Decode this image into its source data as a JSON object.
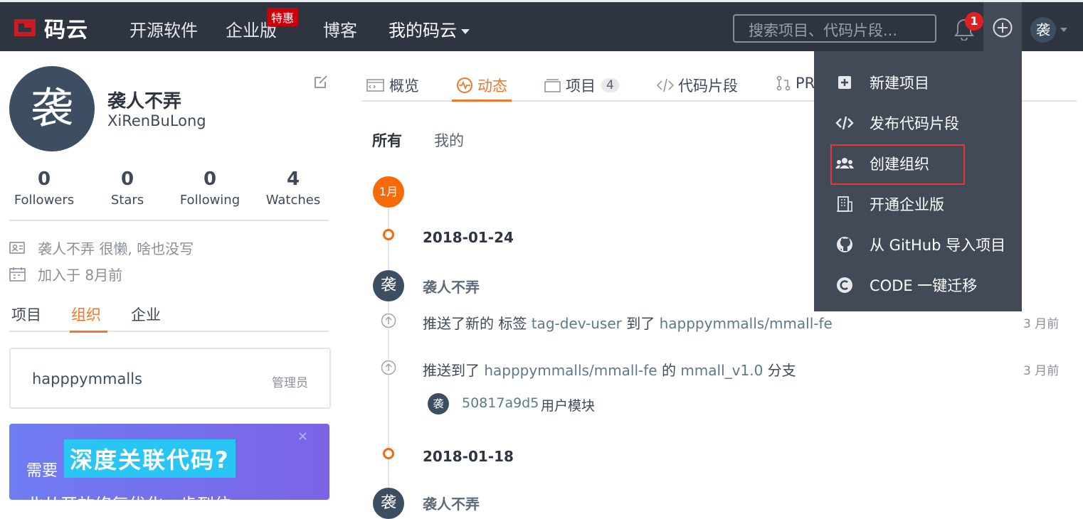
{
  "nav": {
    "logo_text": "码云",
    "items": [
      "开源软件",
      "企业版",
      "博客",
      "我的码云"
    ],
    "hot_badge": "特惠",
    "search_placeholder": "搜索项目、代码片段...",
    "notification_count": "1",
    "user_initial": "袭"
  },
  "profile": {
    "avatar_char": "袭",
    "name": "袭人不弄",
    "username": "XiRenBuLong",
    "stats": [
      {
        "value": "0",
        "label": "Followers"
      },
      {
        "value": "0",
        "label": "Stars"
      },
      {
        "value": "0",
        "label": "Following"
      },
      {
        "value": "4",
        "label": "Watches"
      }
    ],
    "bio": "袭人不弄 很懒, 啥也没写",
    "joined": "加入于 8月前",
    "tabs": [
      "项目",
      "组织",
      "企业"
    ],
    "active_tab": "组织",
    "org": {
      "name": "happpymmalls",
      "role": "管理员"
    },
    "promo": {
      "small": "需要",
      "big": "深度关联代码?",
      "tail": "北从开放修复优化一步到位"
    }
  },
  "main": {
    "tabs": [
      {
        "label": "概览",
        "icon": "overview-icon"
      },
      {
        "label": "动态",
        "icon": "activity-icon"
      },
      {
        "label": "项目",
        "icon": "repo-icon",
        "count": "4"
      },
      {
        "label": "代码片段",
        "icon": "code-icon"
      },
      {
        "label": "PR",
        "icon": "pull-request-icon"
      }
    ],
    "active_tab": "动态",
    "filters": [
      "所有",
      "我的"
    ],
    "active_filter": "所有",
    "timeline": {
      "month": "1月",
      "groups": [
        {
          "date": "2018-01-24",
          "user": "袭人不弄",
          "avatar": "袭",
          "events": [
            {
              "prefix": "推送了新的 标签",
              "tag": "tag-dev-user",
              "mid": "到了",
              "repo": "happpymmalls/mmall-fe",
              "suffix": "",
              "branch": "",
              "ago": "3 月前"
            },
            {
              "prefix": "推送到了",
              "tag": "",
              "mid": "",
              "repo": "happpymmalls/mmall-fe",
              "suffix": "的",
              "branch": "mmall_v1.0",
              "tail": "分支",
              "ago": "3 月前"
            }
          ],
          "commit": {
            "avatar": "袭",
            "hash": "50817a9d5",
            "message": "用户模块"
          }
        },
        {
          "date": "2018-01-18",
          "user": "袭人不弄",
          "avatar": "袭"
        }
      ]
    }
  },
  "dropdown": {
    "items": [
      {
        "label": "新建项目",
        "icon": "plus-square-icon"
      },
      {
        "label": "发布代码片段",
        "icon": "code-icon"
      },
      {
        "label": "创建组织",
        "icon": "users-icon"
      },
      {
        "label": "开通企业版",
        "icon": "building-icon"
      },
      {
        "label": "从 GitHub 导入项目",
        "icon": "github-icon"
      },
      {
        "label": "CODE 一键迁移",
        "icon": "code-migrate-icon"
      }
    ],
    "highlighted": "创建组织"
  },
  "colors": {
    "nav_bg": "#2e3440",
    "accent": "#f1772b",
    "dropdown_bg": "#434a57",
    "highlight": "#e53935"
  }
}
